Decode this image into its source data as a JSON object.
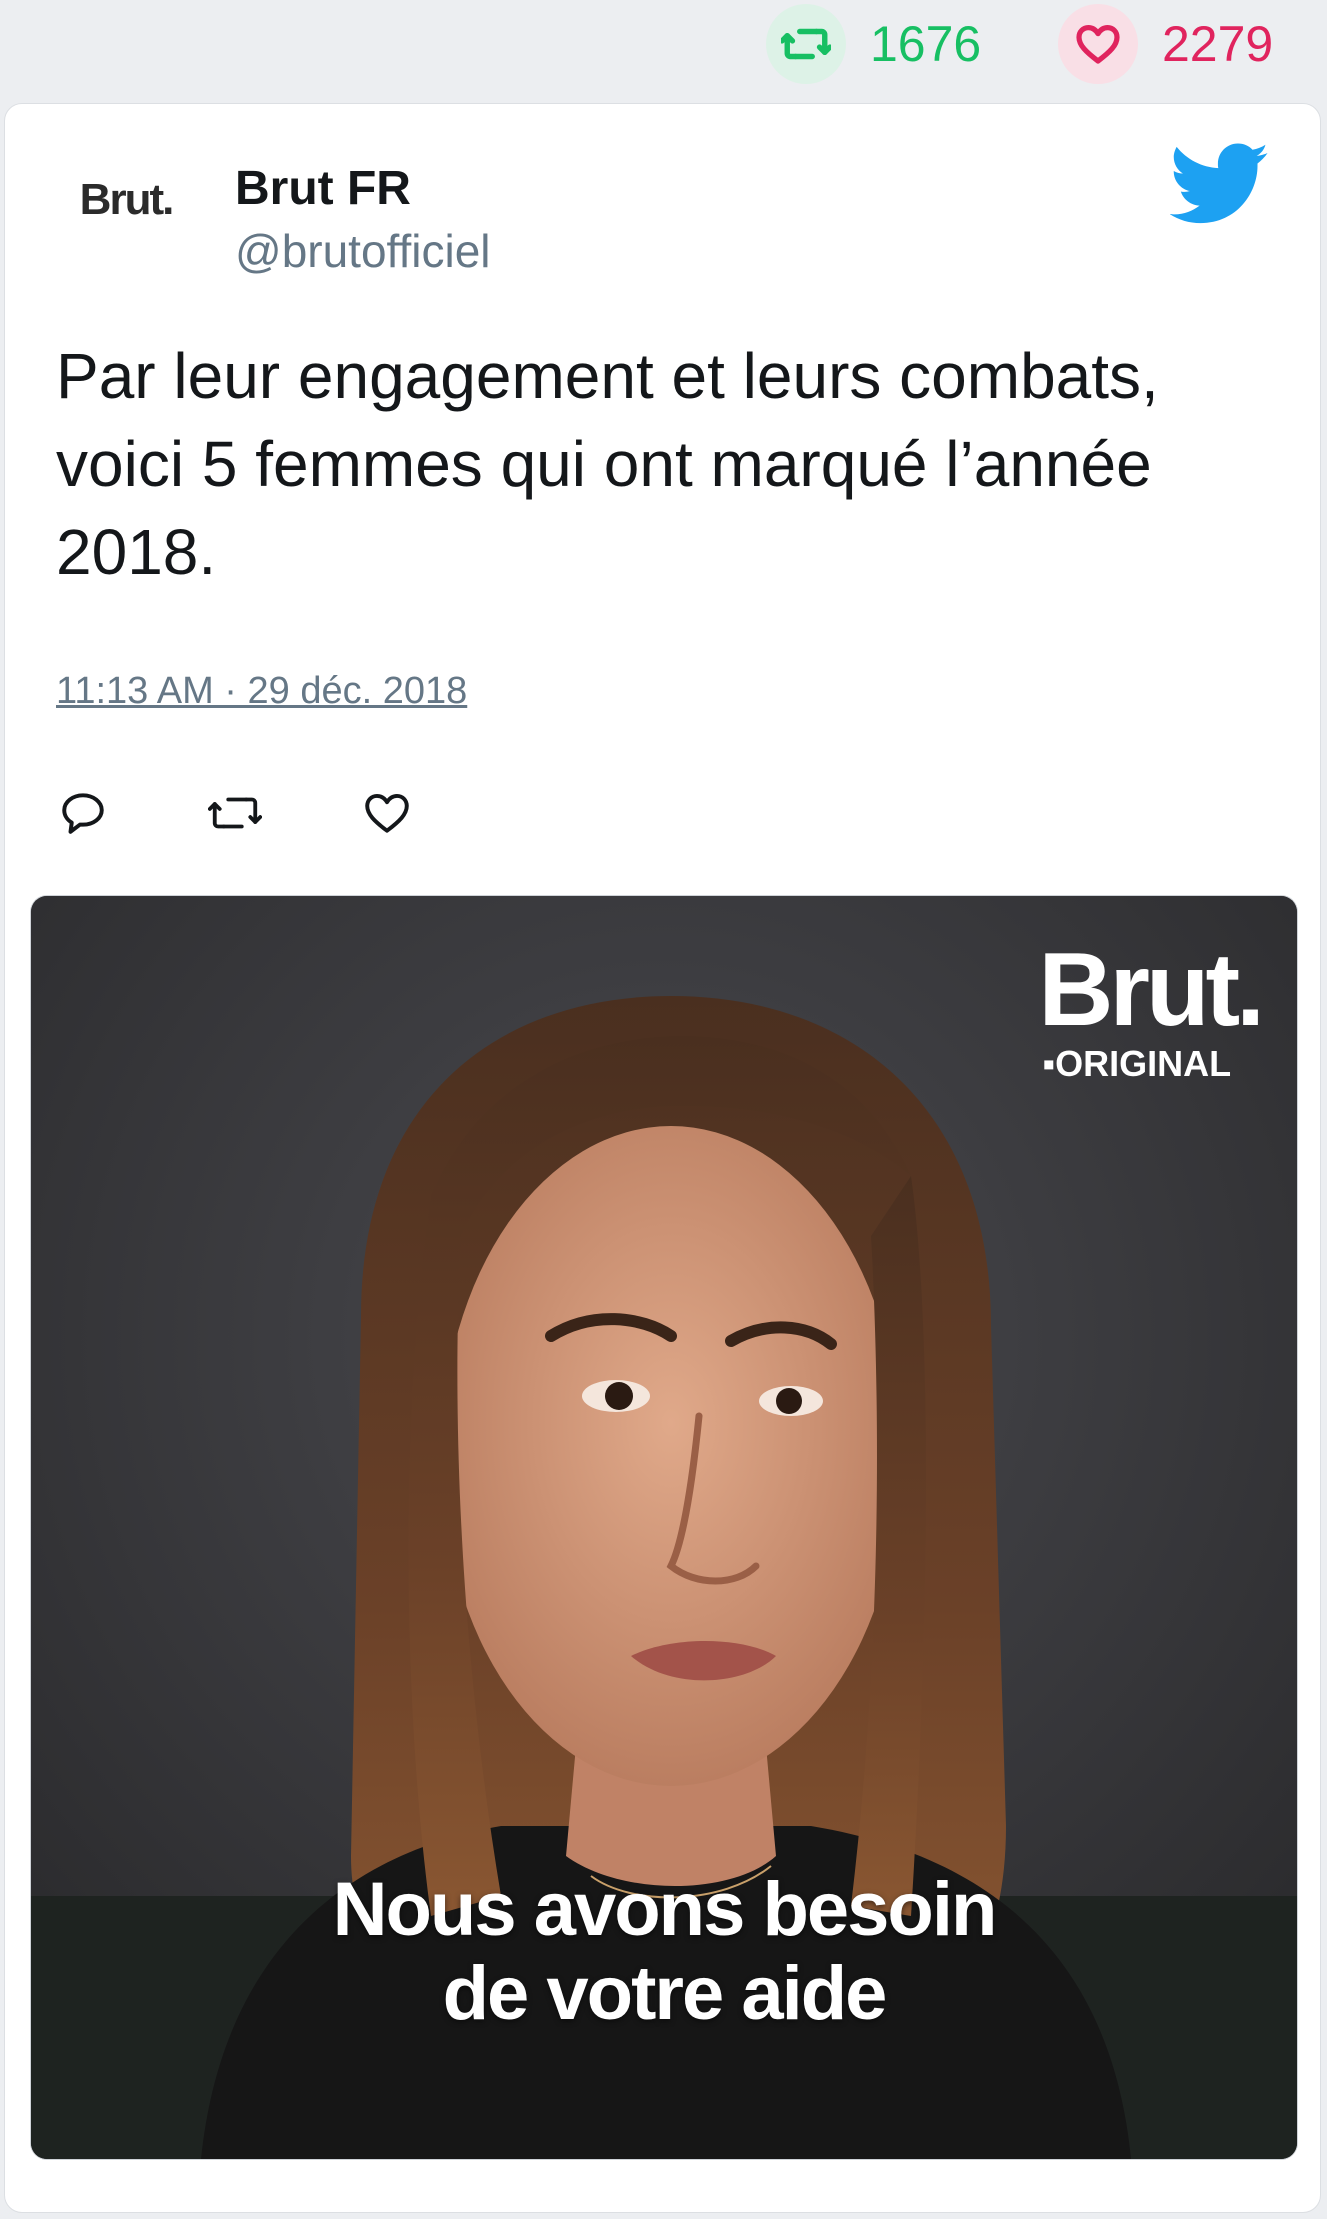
{
  "stats": {
    "retweets": "1676",
    "likes": "2279",
    "retweet_color": "#17bf63",
    "like_color": "#e0245e"
  },
  "tweet": {
    "author": {
      "name": "Brut FR",
      "handle": "@brutofficiel",
      "avatar_text": "Brut."
    },
    "text": "Par leur engagement et leurs combats,\nvoici 5 femmes qui ont marqué l’année\n2018.",
    "timestamp": "11:13 AM · 29 déc. 2018",
    "platform_icon": "twitter-bird-icon",
    "brand_color": "#1da1f2",
    "actions": [
      "reply-icon",
      "retweet-icon",
      "like-icon"
    ]
  },
  "media": {
    "watermark_brand": "Brut.",
    "watermark_sub": "▪ORIGINAL",
    "caption_line1": "Nous avons besoin",
    "caption_line2": "de votre aide"
  }
}
